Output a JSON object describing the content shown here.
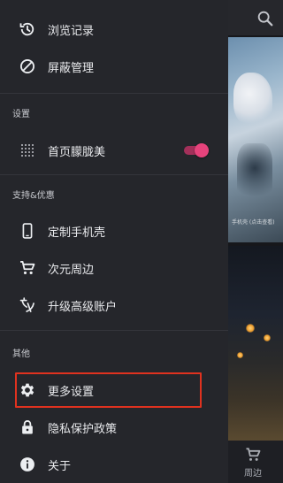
{
  "background": {
    "caption": "手机壳 (点击查看)",
    "bottom_tab": {
      "label": "周边",
      "icon": "cart-icon"
    }
  },
  "drawer": {
    "top_items": [
      {
        "label": "浏览记录",
        "icon": "history-icon"
      },
      {
        "label": "屏蔽管理",
        "icon": "block-icon"
      }
    ],
    "sections": [
      {
        "title": "设置"
      },
      {
        "title": "支持&优惠"
      },
      {
        "title": "其他"
      }
    ],
    "settings_items": [
      {
        "label": "首页朦胧美",
        "icon": "grid-dots-icon",
        "toggle_on": true
      }
    ],
    "support_items": [
      {
        "label": "定制手机壳",
        "icon": "phone-icon"
      },
      {
        "label": "次元周边",
        "icon": "cart-icon"
      },
      {
        "label": "升级高级账户",
        "icon": "vip-icon"
      }
    ],
    "other_items": [
      {
        "label": "更多设置",
        "icon": "gear-icon"
      },
      {
        "label": "隐私保护政策",
        "icon": "lock-icon"
      },
      {
        "label": "关于",
        "icon": "info-icon"
      }
    ]
  },
  "colors": {
    "drawer_bg": "#25262b",
    "toggle_accent": "#e6437c",
    "highlight_border": "#e0321f"
  }
}
